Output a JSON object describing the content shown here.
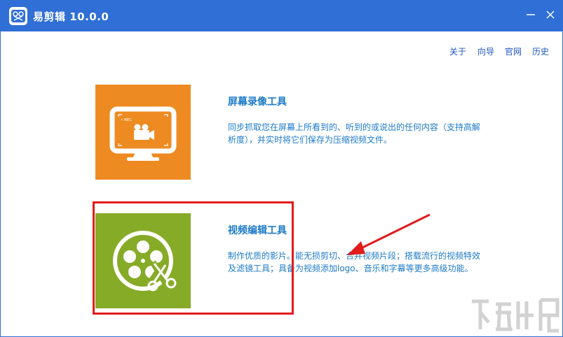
{
  "app": {
    "title": "易剪辑 10.0.0"
  },
  "nav": {
    "about": "关于",
    "guide": "向导",
    "website": "官网",
    "history": "历史"
  },
  "features": [
    {
      "title": "屏幕录像工具",
      "description": "同步抓取您在屏幕上所看到的、听到的或说出的任何内容（支持高解析度），并实时将它们保存为压缩视频文件。",
      "icon": "screen-record-icon",
      "rec_label": "• REC",
      "color": "#ed8b22"
    },
    {
      "title": "视频编辑工具",
      "description": "制作优质的影片。能无损剪切、合并视频片段；搭载流行的视频特效及滤镜工具；具备为视频添加logo、音乐和字幕等更多高级功能。",
      "icon": "film-reel-scissors-icon",
      "color": "#86ab27"
    }
  ],
  "colors": {
    "titlebar": "#2f6fd6",
    "link": "#1f56c2",
    "feature_text": "#1d7bc9",
    "annotation": "#e01b1b"
  }
}
